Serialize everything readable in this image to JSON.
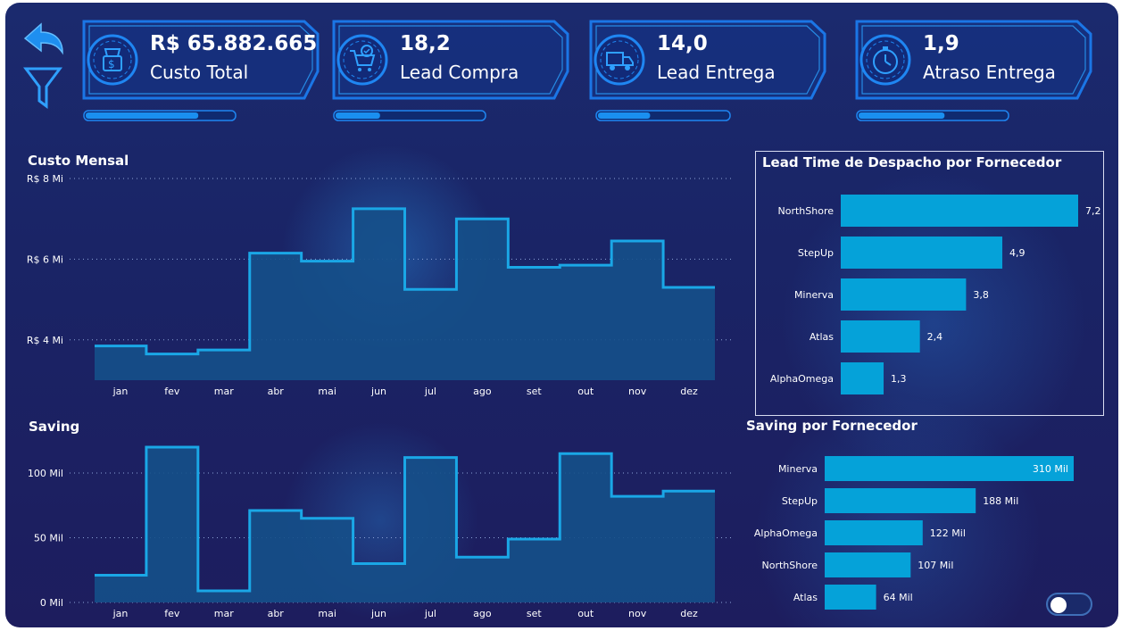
{
  "kpis": [
    {
      "value": "R$ 65.882.665",
      "label": "Custo Total",
      "icon": "money-bag-icon",
      "progress": 0.76
    },
    {
      "value": "18,2",
      "label": "Lead Compra",
      "icon": "shopping-cart-check-icon",
      "progress": 0.3
    },
    {
      "value": "14,0",
      "label": "Lead Entrega",
      "icon": "delivery-truck-icon",
      "progress": 0.4
    },
    {
      "value": "1,9",
      "label": "Atraso Entrega",
      "icon": "stopwatch-icon",
      "progress": 0.58
    }
  ],
  "nav": {
    "back_icon": "back-arrow-icon",
    "filter_icon": "filter-funnel-icon"
  },
  "colors": {
    "accent": "#1e90e8",
    "bar": "#05a2d9",
    "area_line": "#1aa7e6",
    "area_fill": "#15508a"
  },
  "custo_mensal": {
    "title": "Custo Mensal",
    "chart_data": {
      "type": "area",
      "step": true,
      "categories": [
        "jan",
        "fev",
        "mar",
        "abr",
        "mai",
        "jun",
        "jul",
        "ago",
        "set",
        "out",
        "nov",
        "dez"
      ],
      "values": [
        3.85,
        3.65,
        3.75,
        6.15,
        5.95,
        7.25,
        5.25,
        7.0,
        5.8,
        5.85,
        6.45,
        5.3
      ],
      "yticks": [
        "R$ 4 Mi",
        "R$ 6 Mi",
        "R$ 8 Mi"
      ],
      "ytick_values": [
        4,
        6,
        8
      ],
      "ylim": [
        3.0,
        8.0
      ],
      "grid": true
    }
  },
  "saving": {
    "title": "Saving",
    "chart_data": {
      "type": "area",
      "step": true,
      "categories": [
        "jan",
        "fev",
        "mar",
        "abr",
        "mai",
        "jun",
        "jul",
        "ago",
        "set",
        "out",
        "nov",
        "dez"
      ],
      "values": [
        21,
        120,
        9,
        71,
        65,
        30,
        112,
        35,
        49,
        115,
        82,
        86
      ],
      "yticks": [
        "0 Mil",
        "50 Mil",
        "100 Mil"
      ],
      "ytick_values": [
        0,
        50,
        100
      ],
      "ylim": [
        0,
        120
      ],
      "grid": true
    }
  },
  "lead_time": {
    "title": "Lead Time de Despacho por Fornecedor",
    "chart_data": {
      "type": "bar",
      "orientation": "horizontal",
      "categories": [
        "NorthShore",
        "StepUp",
        "Minerva",
        "Atlas",
        "AlphaOmega"
      ],
      "values": [
        7.2,
        4.9,
        3.8,
        2.4,
        1.3
      ],
      "labels": [
        "7,2",
        "4,9",
        "3,8",
        "2,4",
        "1,3"
      ],
      "xlim": [
        0,
        7.2
      ]
    }
  },
  "saving_fornecedor": {
    "title": "Saving por Fornecedor",
    "chart_data": {
      "type": "bar",
      "orientation": "horizontal",
      "categories": [
        "Minerva",
        "StepUp",
        "AlphaOmega",
        "NorthShore",
        "Atlas"
      ],
      "values": [
        310,
        188,
        122,
        107,
        64
      ],
      "labels": [
        "310 Mil",
        "188 Mil",
        "122 Mil",
        "107 Mil",
        "64 Mil"
      ],
      "xlim": [
        0,
        310
      ]
    }
  },
  "toggle": {
    "state": "off"
  }
}
